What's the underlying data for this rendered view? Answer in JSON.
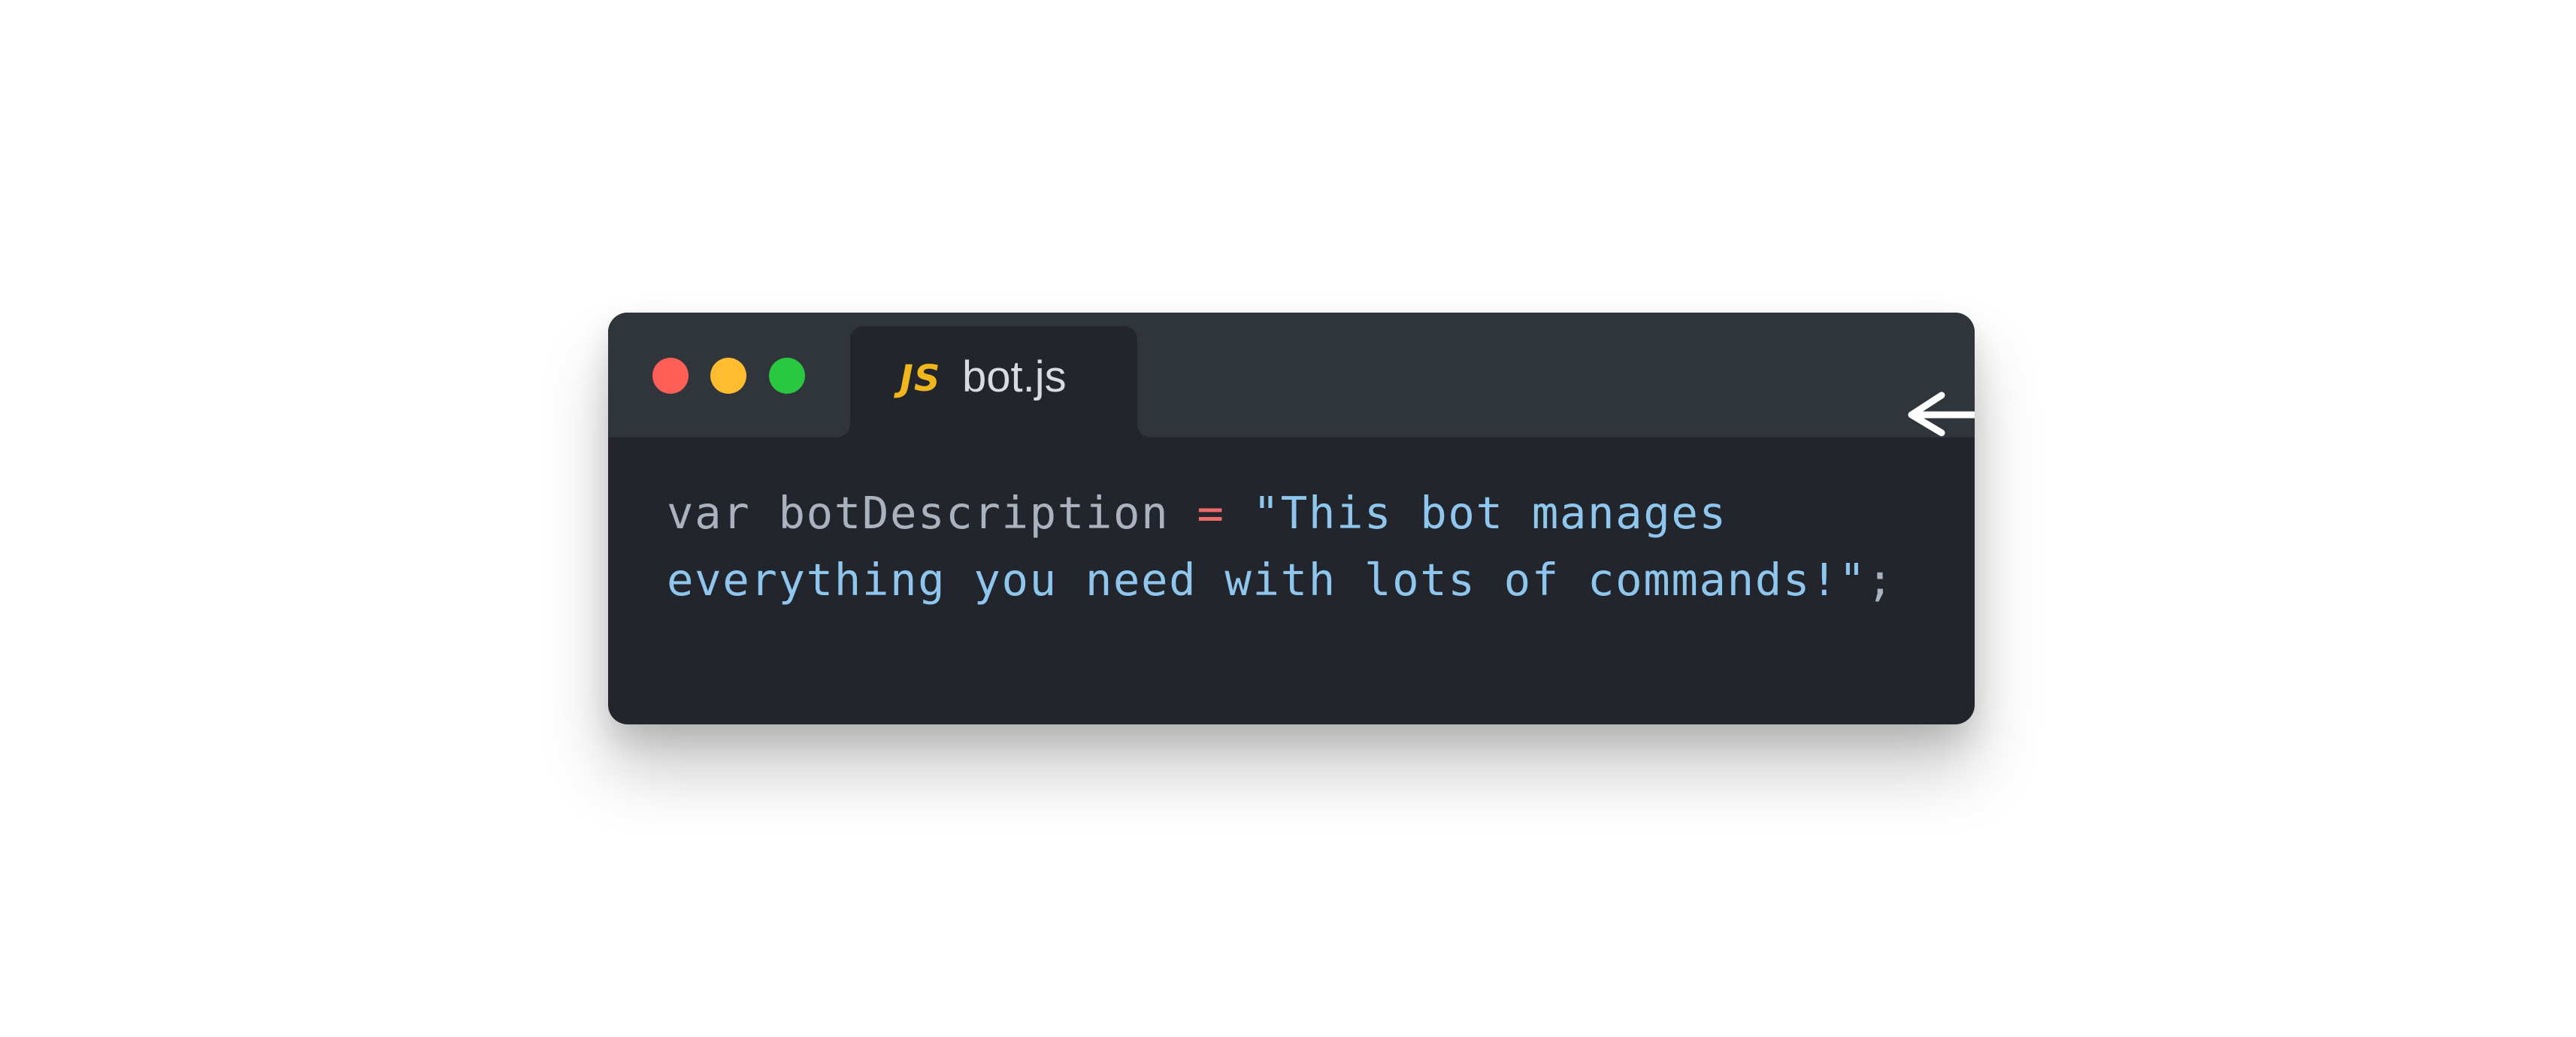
{
  "window": {
    "traffic_lights": [
      "close",
      "minimize",
      "maximize"
    ]
  },
  "tab": {
    "icon_text": "JS",
    "label": "bot.js"
  },
  "code": {
    "keyword": "var",
    "identifier": "botDescription",
    "operator": "=",
    "string_line1": "\"This bot manages",
    "string_line2": "everything you need with lots of commands!\"",
    "terminator": ";"
  },
  "colors": {
    "window_bg": "#22262c",
    "titlebar_bg": "#30343b",
    "close": "#ff5f57",
    "minimize": "#febc2e",
    "maximize": "#28c840",
    "js_icon": "#f0b71d",
    "operator": "#ef6b6b",
    "string": "#8fc6ee",
    "plain": "#abb2bf"
  },
  "icons": {
    "arrow": "arrow-left-icon"
  }
}
